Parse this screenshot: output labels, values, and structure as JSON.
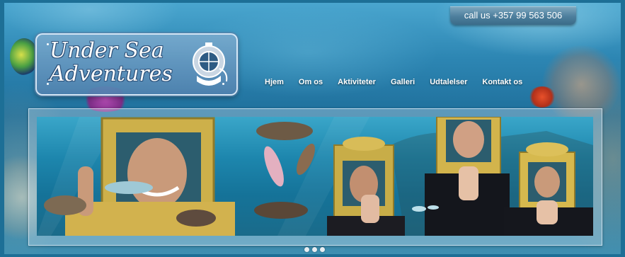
{
  "header": {
    "call_label": "call us +357 99 563 506"
  },
  "logo": {
    "line1": "Under Sea",
    "line2": "Adventures",
    "icon": "diving-helmet-icon"
  },
  "nav": {
    "items": [
      {
        "label": "Hjem"
      },
      {
        "label": "Om os"
      },
      {
        "label": "Aktiviteter"
      },
      {
        "label": "Galleri"
      },
      {
        "label": "Udtalelser"
      },
      {
        "label": "Kontakt os"
      }
    ]
  },
  "slider": {
    "image": "divers-in-helmets-underwater-photo",
    "dots": 3,
    "active_dot": 1
  },
  "colors": {
    "water_dark": "#1f6f9b",
    "water_light": "#4aa6cf",
    "helmet_gold": "#d8b64a",
    "call_button": "#4d7f9d"
  }
}
